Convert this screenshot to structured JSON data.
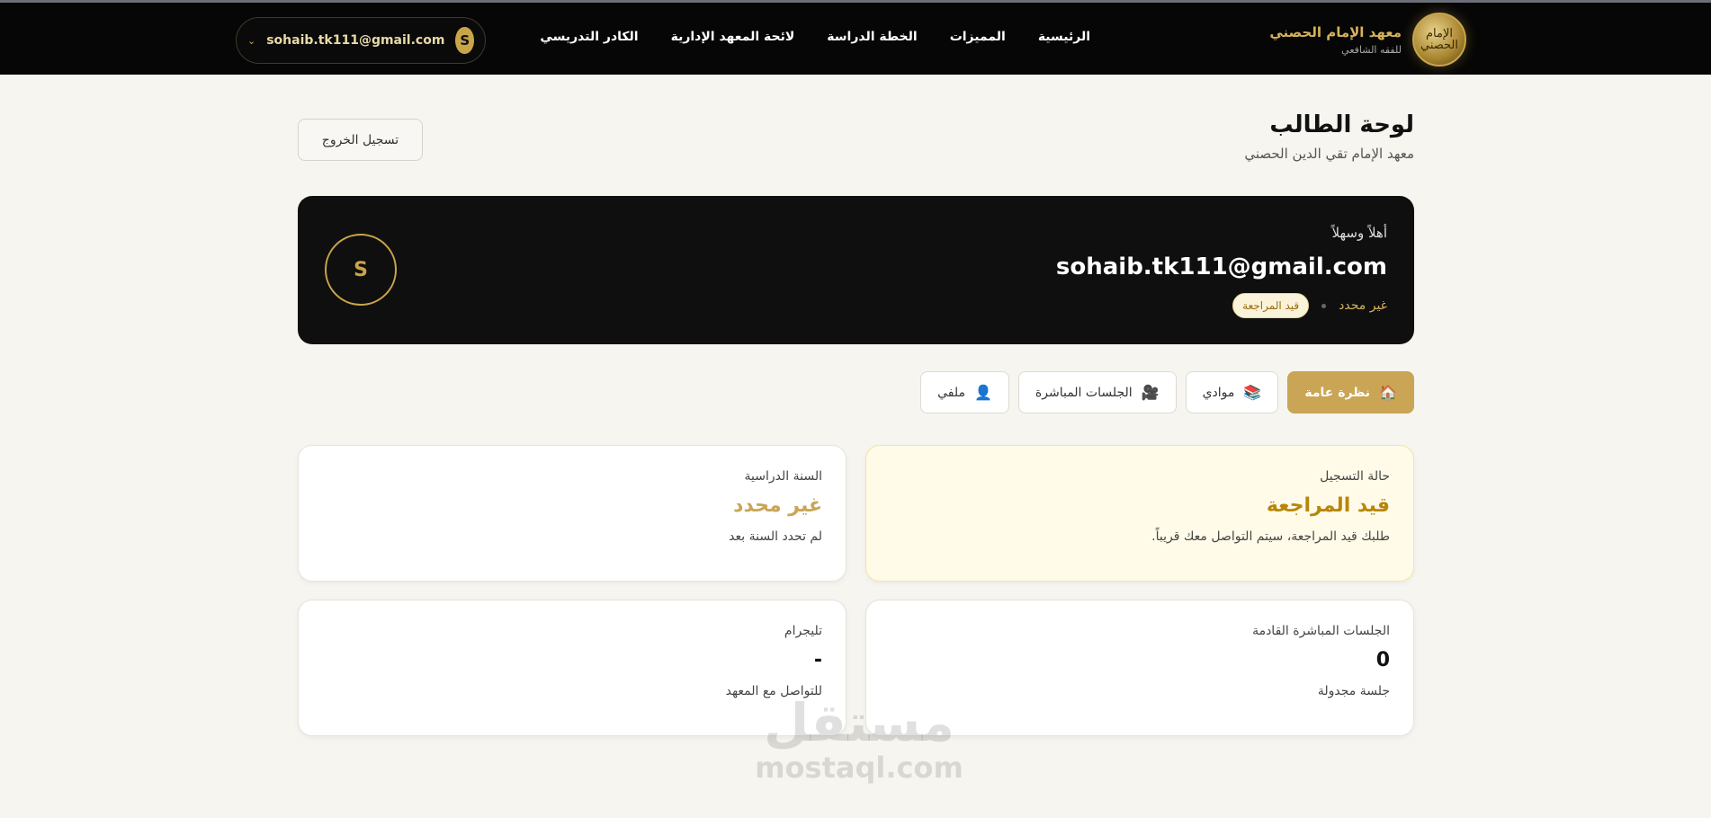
{
  "header": {
    "brand_name": "معهد الإمام الحصني",
    "brand_sub": "للفقه الشافعي",
    "logo_text": "الإمام الحصني",
    "nav": [
      "الرئيسية",
      "المميزات",
      "الخطة الدراسة",
      "لائحة المعهد الإدارية",
      "الكادر التدريسي"
    ],
    "user_email": "sohaib.tk111@gmail.com",
    "user_initial": "S",
    "chevron": "⌄"
  },
  "page": {
    "title": "لوحة الطالب",
    "subtitle": "معهد الإمام تقي الدين الحصني",
    "logout": "تسجيل الخروج"
  },
  "hero": {
    "welcome": "أهلاً وسهلاً",
    "email": "sohaib.tk111@gmail.com",
    "level": "غير محدد",
    "status_badge": "قيد المراجعة",
    "initial": "S"
  },
  "tabs": [
    {
      "label": "نظرة عامة",
      "icon": "🏠",
      "icon_name": "home-icon"
    },
    {
      "label": "موادي",
      "icon": "📚",
      "icon_name": "books-icon"
    },
    {
      "label": "الجلسات المباشرة",
      "icon": "🎥",
      "icon_name": "video-camera-icon"
    },
    {
      "label": "ملفي",
      "icon": "👤",
      "icon_name": "user-icon"
    }
  ],
  "cards": {
    "registration": {
      "label": "حالة التسجيل",
      "value": "قيد المراجعة",
      "sub": "طلبك قيد المراجعة، سيتم التواصل معك قريباً."
    },
    "study_year": {
      "label": "السنة الدراسية",
      "value": "غير محدد",
      "sub": "لم تحدد السنة بعد"
    },
    "sessions": {
      "label": "الجلسات المباشرة القادمة",
      "value": "0",
      "sub": "جلسة مجدولة"
    },
    "telegram": {
      "label": "تليجرام",
      "value": "-",
      "sub": "للتواصل مع المعهد"
    }
  },
  "watermark": {
    "ar": "مستقل",
    "en": "mostaql.com"
  },
  "colors": {
    "gold": "#c9a555",
    "dark": "#0f0f0f",
    "pending": "#b8860b",
    "undefined": "#c9a555"
  }
}
